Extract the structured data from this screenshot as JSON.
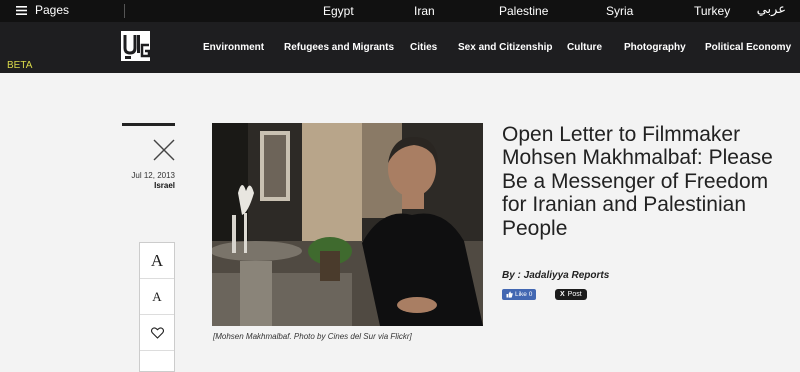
{
  "topbar": {
    "pages_label": "Pages",
    "countries": [
      "Egypt",
      "Iran",
      "Palestine",
      "Syria",
      "Turkey"
    ],
    "arabic_link": "عربي"
  },
  "nav": {
    "items": [
      "Environment",
      "Refugees and Migrants",
      "Cities",
      "Sex and Citizenship",
      "Culture",
      "Photography",
      "Political Economy"
    ],
    "beta_label": "BETA"
  },
  "article": {
    "date": "Jul 12, 2013",
    "tag": "Israel",
    "title": "Open Letter to Filmmaker Mohsen Makhmalbaf: Please Be a Messenger of Freedom for Iranian and Palestinian People",
    "byline_prefix": "By : ",
    "byline_author": "Jadaliyya Reports",
    "caption": "[Mohsen Makhmalbaf. Photo by Cines del Sur via Flickr]"
  },
  "tools": {
    "font_large": "A",
    "font_small": "A"
  },
  "social": {
    "fb_like_label": "Like 0",
    "tweet_label": "Post"
  },
  "colors": {
    "topbar_bg": "#111111",
    "navbar_bg": "#1e1e20",
    "beta": "#d8d84a",
    "fb_blue": "#4267b2"
  }
}
